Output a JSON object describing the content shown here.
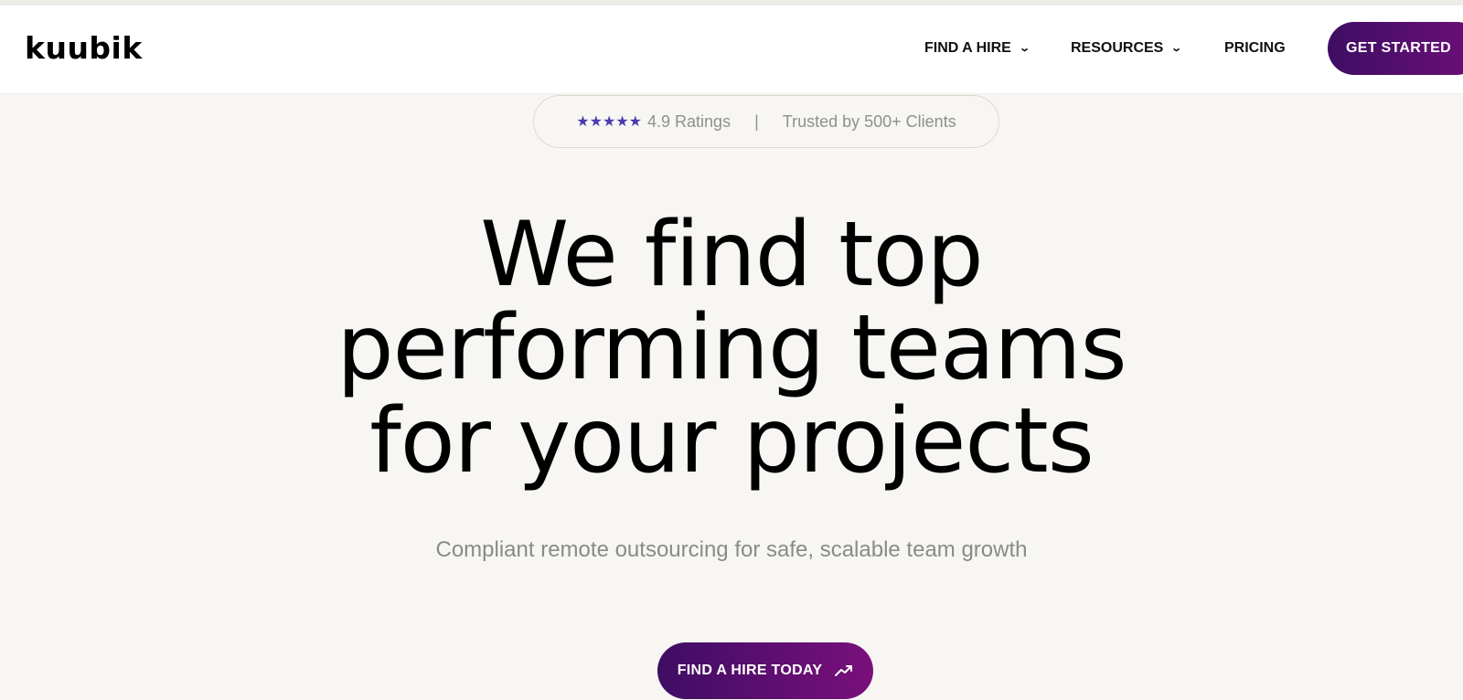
{
  "brand": {
    "logo_text": "kuubik"
  },
  "nav": {
    "items": [
      {
        "label": "FIND A HIRE",
        "has_dropdown": true
      },
      {
        "label": "RESOURCES",
        "has_dropdown": true
      },
      {
        "label": "PRICING",
        "has_dropdown": false
      }
    ],
    "cta_label": "GET STARTED"
  },
  "ratings": {
    "stars": "★★★★★",
    "rating_text": "4.9 Ratings",
    "separator": "|",
    "trusted_text": "Trusted by 500+ Clients"
  },
  "hero": {
    "title_lines": [
      "We find top",
      "performing teams",
      "for your projects"
    ],
    "subtitle": "Compliant remote outsourcing for safe, scalable team growth",
    "button_label": "FIND A HIRE TODAY"
  },
  "colors": {
    "accent_start": "#3e0e63",
    "accent_end": "#7a0f7c",
    "star": "#4b3bb0",
    "background": "#f7f6f3"
  }
}
